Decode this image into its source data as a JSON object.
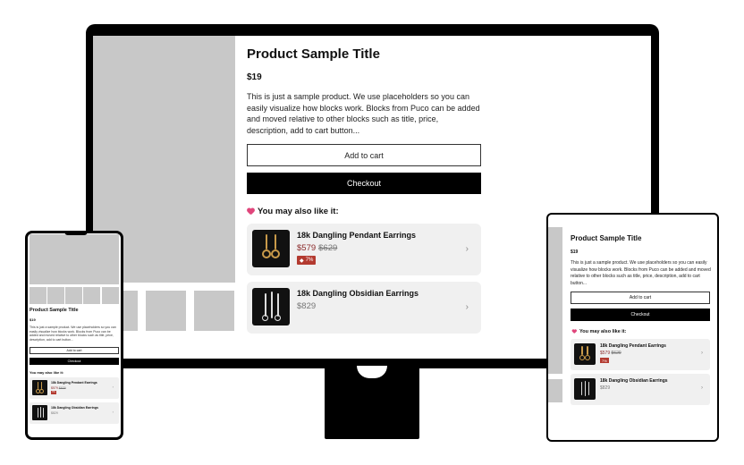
{
  "product": {
    "title": "Product Sample Title",
    "price": "$19",
    "description": "This is just a sample product. We use placeholders so you can easily visualize how blocks work. Blocks from Puco can be added and moved relative to other blocks such as title, price, description, add to cart button...",
    "add_to_cart_label": "Add to cart",
    "checkout_label": "Checkout"
  },
  "recommendations": {
    "heading": "You may also like it:",
    "items": [
      {
        "name": "18k Dangling Pendant Earrings",
        "price": "$579",
        "old_price": "$629",
        "badge": "7%"
      },
      {
        "name": "18k Dangling Obsidian Earrings",
        "price": "$829"
      }
    ]
  },
  "icons": {
    "heart": "heart-icon",
    "tag": "tag-icon",
    "chevron": "chevron-right-icon"
  },
  "colors": {
    "accent_black": "#000000",
    "sale_price": "#8b2a2a",
    "badge_bg": "#b33a30",
    "placeholder": "#c8c8c8",
    "card_bg": "#f0f0f0"
  }
}
